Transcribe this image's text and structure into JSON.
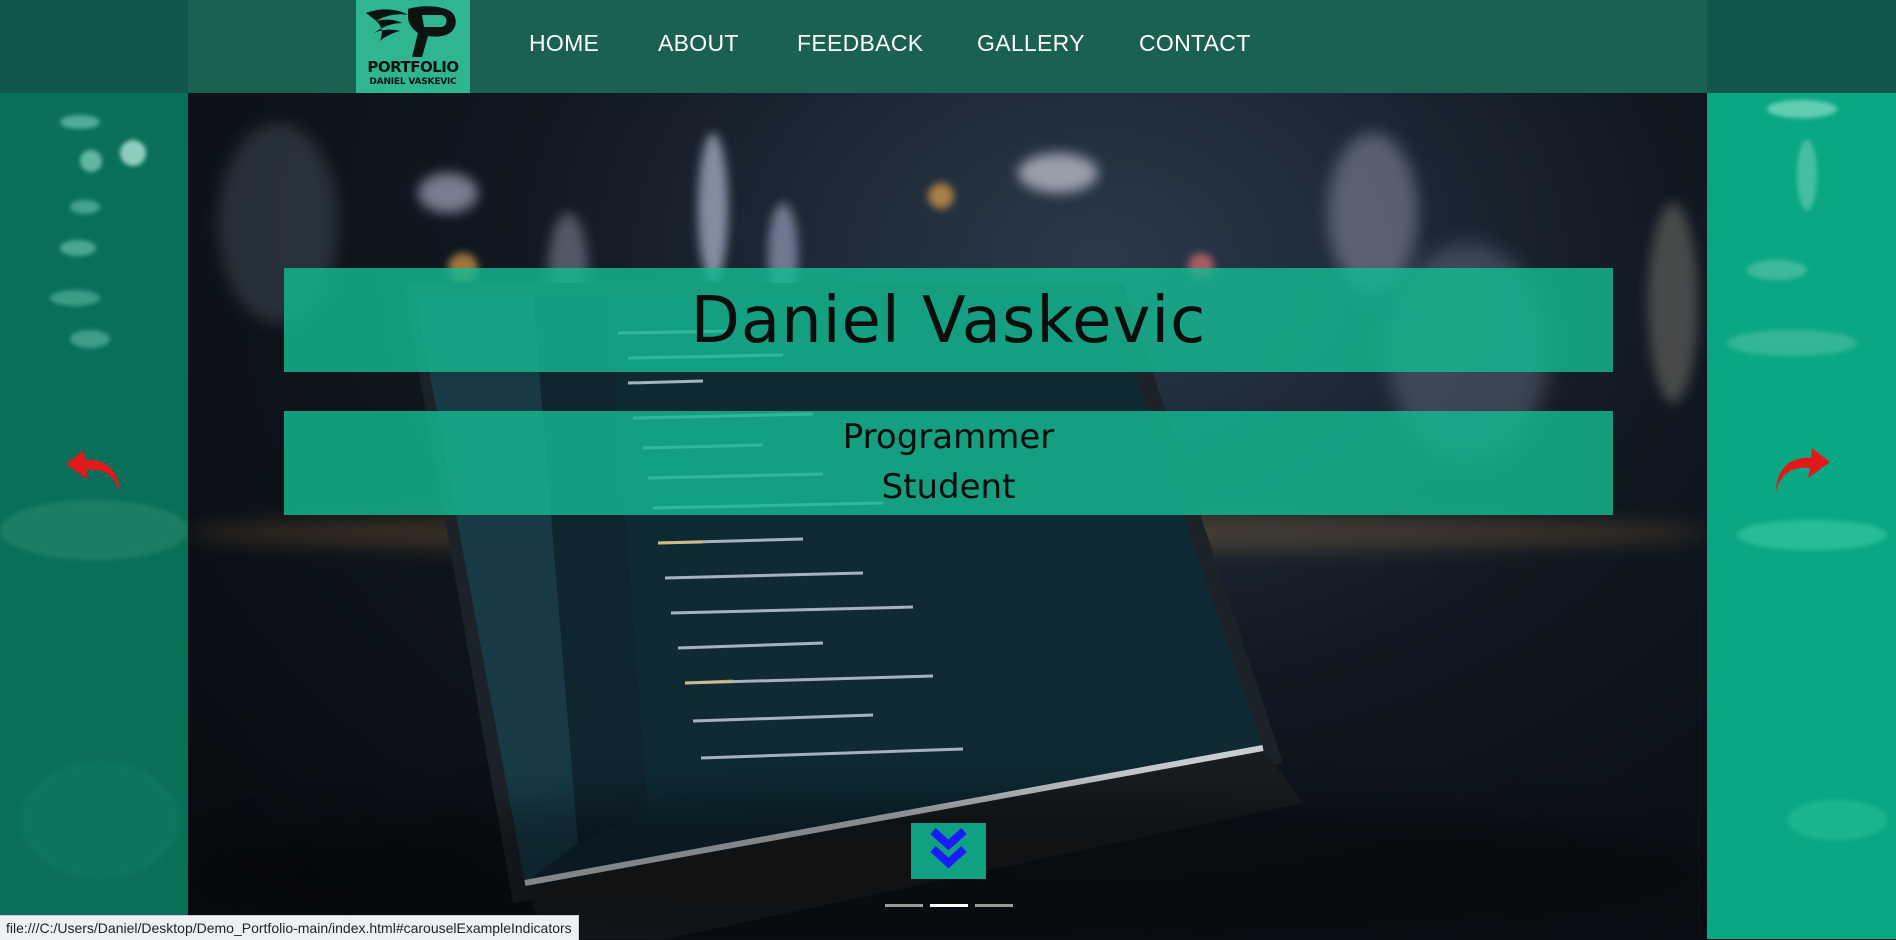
{
  "logo": {
    "line1": "PORTFOLIO",
    "line2": "DANIEL VASKEVIC"
  },
  "nav": {
    "items": [
      "HOME",
      "ABOUT",
      "FEEDBACK",
      "GALLERY",
      "CONTACT"
    ]
  },
  "hero": {
    "title": "Daniel Vaskevic",
    "subtitle_line1": "Programmer",
    "subtitle_line2": "Student"
  },
  "carousel": {
    "prev_icon": "curved-arrow-left-icon",
    "next_icon": "curved-arrow-right-icon",
    "indicator_count": 3,
    "active_indicator": 1
  },
  "scroll_button": {
    "icon": "double-chevron-down-icon"
  },
  "status_bar": {
    "url": "file:///C:/Users/Daniel/Desktop/Demo_Portfolio-main/index.html#carouselExampleIndicators"
  },
  "colors": {
    "header": "#1b6152",
    "accent_teal": "#16b991",
    "arrow_red": "#e01a1a",
    "chevron_blue": "#1a1aff"
  }
}
